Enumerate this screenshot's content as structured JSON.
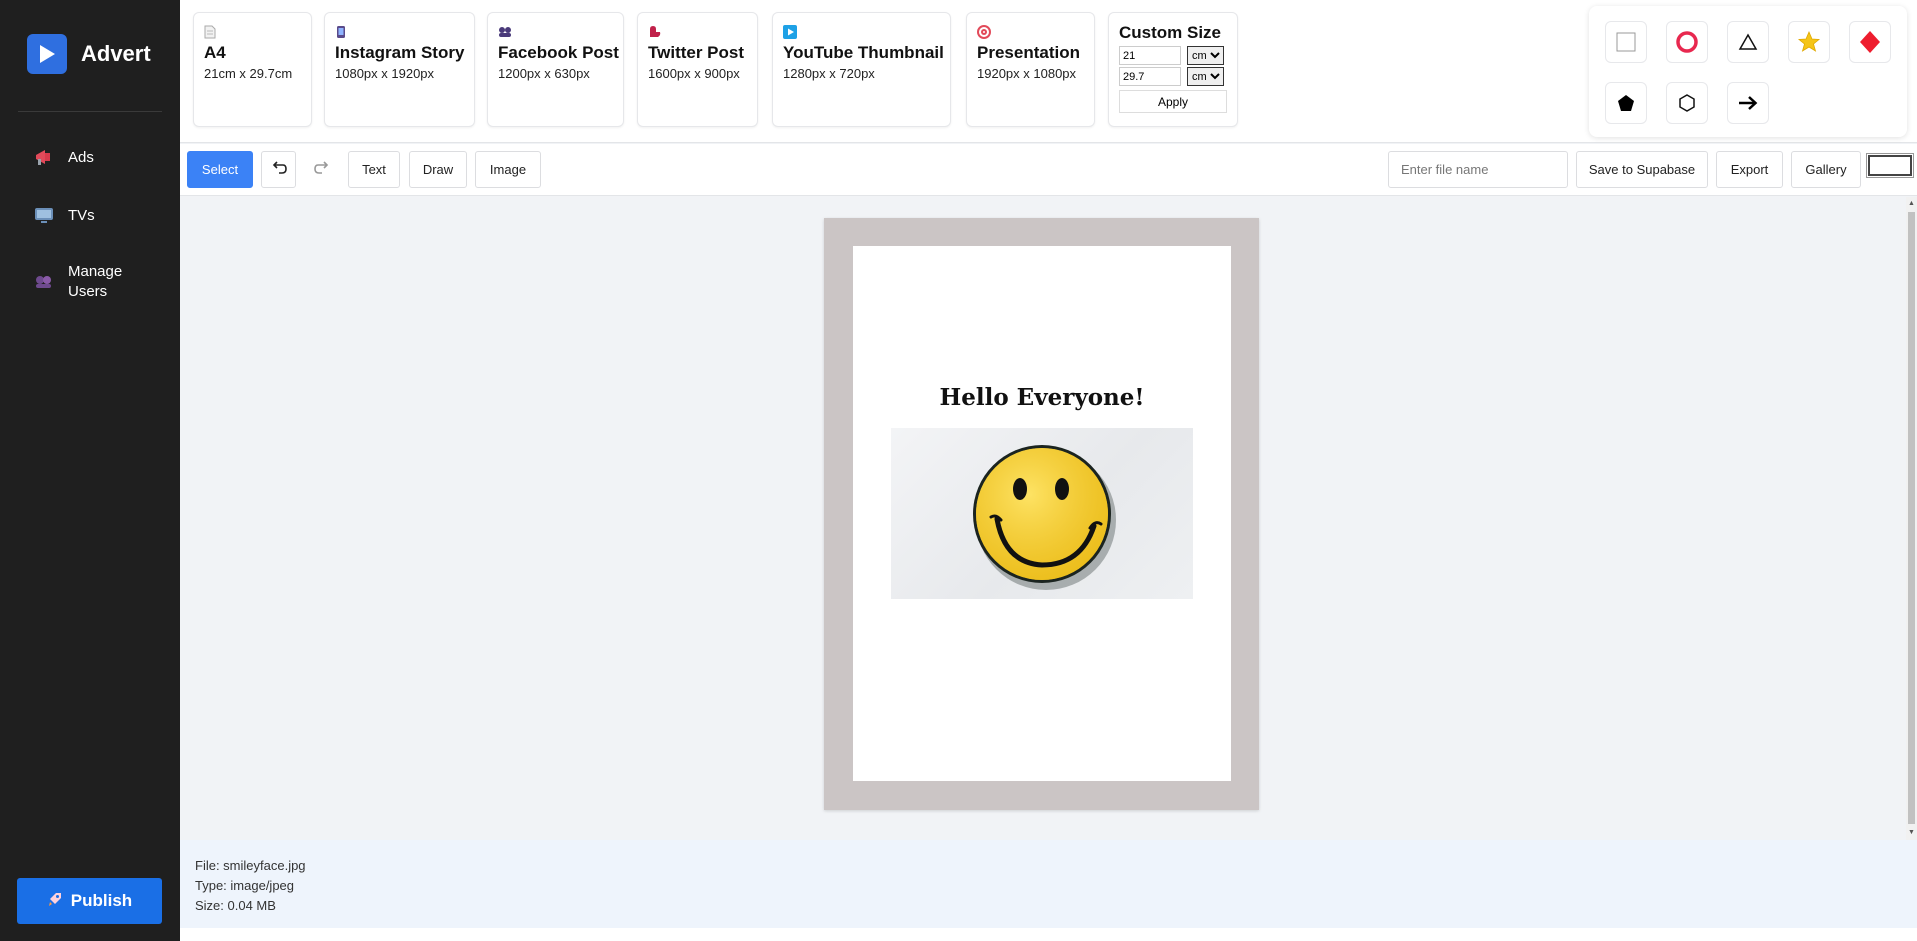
{
  "sidebar": {
    "brand": "Advert",
    "items": [
      {
        "label": "Ads"
      },
      {
        "label": "TVs"
      },
      {
        "label": "Manage Users"
      }
    ],
    "publish_label": "Publish"
  },
  "presets": [
    {
      "name": "A4",
      "dims": "21cm x 29.7cm"
    },
    {
      "name": "Instagram Story",
      "dims": "1080px x 1920px"
    },
    {
      "name": "Facebook Post",
      "dims": "1200px x 630px"
    },
    {
      "name": "Twitter Post",
      "dims": "1600px x 900px"
    },
    {
      "name": "YouTube Thumbnail",
      "dims": "1280px x 720px"
    },
    {
      "name": "Presentation",
      "dims": "1920px x 1080px"
    }
  ],
  "custom_size": {
    "title": "Custom Size",
    "width": "21",
    "height": "29.7",
    "unit": "cm",
    "apply_label": "Apply"
  },
  "shapes": [
    "square-icon",
    "circle-icon",
    "triangle-icon",
    "star-icon",
    "diamond-icon",
    "pentagon-icon",
    "hexagon-icon",
    "arrow-icon"
  ],
  "toolbar": {
    "select_label": "Select",
    "text_label": "Text",
    "draw_label": "Draw",
    "image_label": "Image",
    "filename_placeholder": "Enter file name",
    "save_label": "Save to Supabase",
    "export_label": "Export",
    "gallery_label": "Gallery"
  },
  "canvas": {
    "headline": "Hello Everyone!"
  },
  "file_info": {
    "file": "File: smileyface.jpg",
    "type": "Type: image/jpeg",
    "size": "Size: 0.04 MB"
  },
  "colors": {
    "accent": "#3b82f6",
    "publish": "#1a6fe6",
    "sidebar_bg": "#1f1f1f",
    "frame": "#cbc5c5"
  }
}
